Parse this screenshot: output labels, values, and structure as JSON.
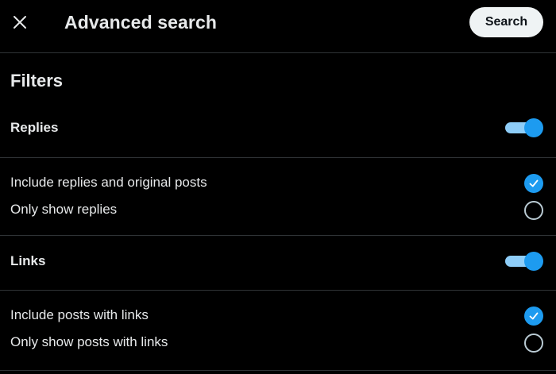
{
  "header": {
    "title": "Advanced search",
    "search_label": "Search",
    "close_icon": "close-icon"
  },
  "filters_title": "Filters",
  "sections": [
    {
      "label": "Replies",
      "toggle_on": true,
      "options": [
        {
          "label": "Include replies and original posts",
          "checked": true
        },
        {
          "label": "Only show replies",
          "checked": false
        }
      ]
    },
    {
      "label": "Links",
      "toggle_on": true,
      "options": [
        {
          "label": "Include posts with links",
          "checked": true
        },
        {
          "label": "Only show posts with links",
          "checked": false
        }
      ]
    }
  ],
  "colors": {
    "background": "#000000",
    "accent": "#1d9bf0",
    "text": "#e7e9ea",
    "divider": "#2f3336"
  }
}
